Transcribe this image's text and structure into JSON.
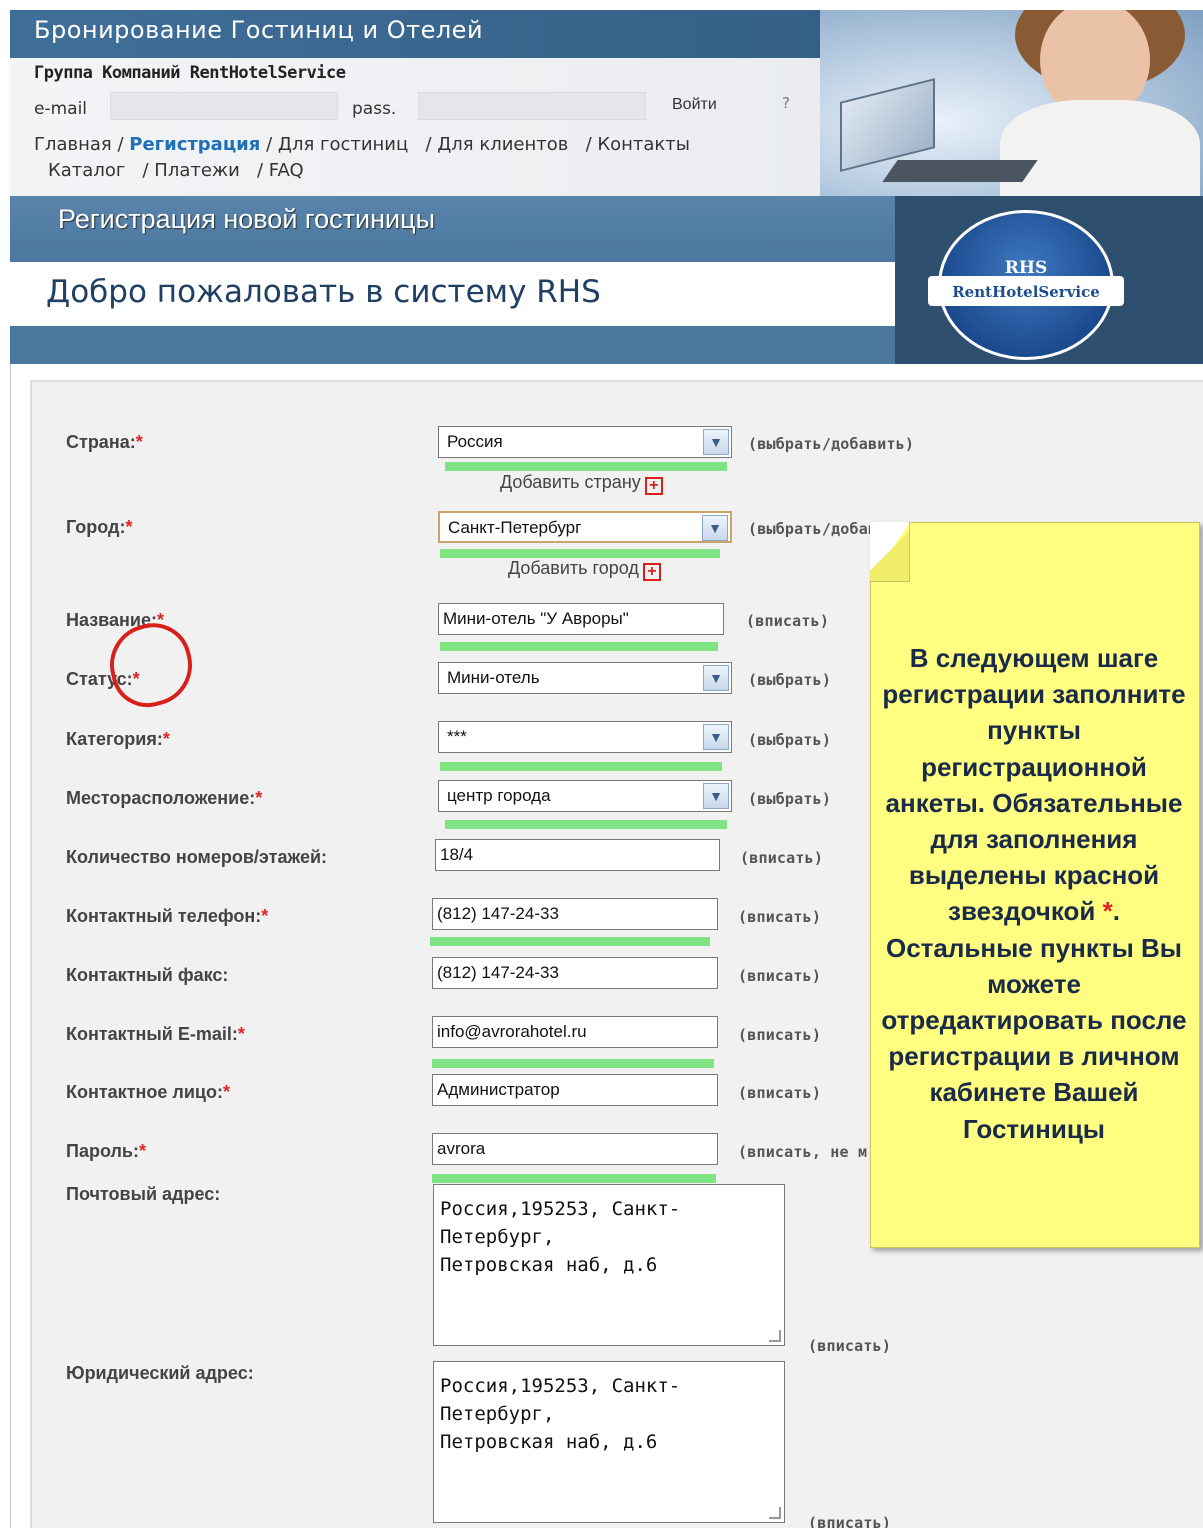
{
  "header": {
    "site_title": "Бронирование Гостиниц и Отелей",
    "company": "Группа Компаний RentHotelService",
    "email_label": "e-mail",
    "pass_label": "pass.",
    "login_button": "Войти",
    "help_button": "?"
  },
  "nav": {
    "row1": [
      "Главная",
      "Регистрация",
      "Для гостиниц",
      "Для клиентов",
      "Контакты"
    ],
    "row2": [
      "Каталог",
      "Платежи",
      "FAQ"
    ],
    "active": "Регистрация"
  },
  "page": {
    "section_title": "Регистрация новой гостиницы",
    "welcome": "Добро пожаловать в систему RHS",
    "logo_short": "RHS",
    "logo_name": "RentHotelService"
  },
  "form": {
    "country": {
      "label": "Страна:",
      "value": "Россия",
      "hint": "(выбрать/добавить)",
      "add_link": "Добавить страну"
    },
    "city": {
      "label": "Город:",
      "value": "Санкт-Петербург",
      "hint": "(выбрать/добави",
      "add_link": "Добавить город"
    },
    "name": {
      "label": "Название:",
      "value": "Мини-отель \"У Авроры\"",
      "hint": "(вписать)"
    },
    "status": {
      "label": "Статус:",
      "value": "Мини-отель",
      "hint": "(выбрать)"
    },
    "category": {
      "label": "Категория:",
      "value": "***",
      "hint": "(выбрать)"
    },
    "location": {
      "label": "Месторасположение:",
      "value": "центр города",
      "hint": "(выбрать)"
    },
    "rooms": {
      "label": "Количество номеров/этажей:",
      "value": "18/4",
      "hint": "(вписать)"
    },
    "phone": {
      "label": "Контактный телефон:",
      "value": "(812) 147-24-33",
      "hint": "(вписать)"
    },
    "fax": {
      "label": "Контактный факс:",
      "value": "(812) 147-24-33",
      "hint": "(вписать)"
    },
    "email": {
      "label": "Контактный E-mail:",
      "value": "info@avrorahotel.ru",
      "hint": "(вписать)"
    },
    "person": {
      "label": "Контактное лицо:",
      "value": "Администратор",
      "hint": "(вписать)"
    },
    "password": {
      "label": "Пароль:",
      "value": "avrora",
      "hint": "(вписать, не м"
    },
    "postal": {
      "label": "Почтовый адрес:",
      "value": "Россия,195253, Санкт-\nПетербург,\nПетровская наб, д.6",
      "hint": "(вписать)"
    },
    "legal": {
      "label": "Юридический адрес:",
      "value": "Россия,195253, Санкт-\nПетербург,\nПетровская наб, д.6",
      "hint": "(вписать)"
    },
    "required_mark": "*"
  },
  "note": {
    "text": "В следующем шаге регистрации заполните пункты регистрационной анкеты. Обязательные для заполнения выделены красной звездочкой",
    "star": "*",
    "text_after": ". Остальные пункты Вы можете отредактировать после регистрации в личном кабинете Вашей Гостиницы"
  },
  "colors": {
    "title_bar": "#3f6f99",
    "band": "#4b769e",
    "required": "#e0241f",
    "highlight": "#7fe384",
    "note_bg": "#fffe80"
  }
}
